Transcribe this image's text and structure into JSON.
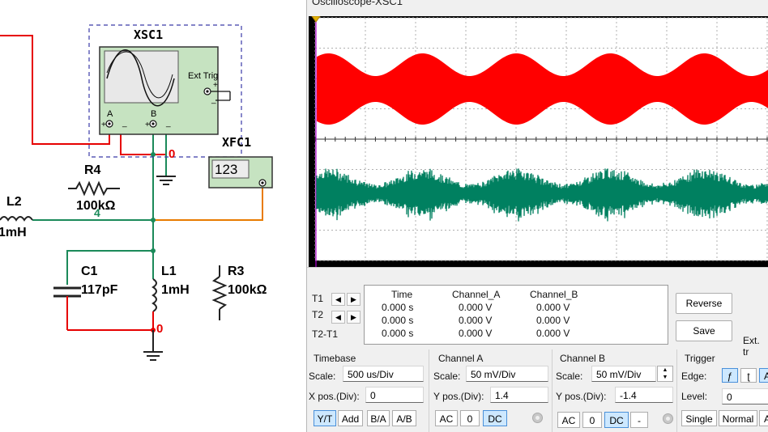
{
  "schematic": {
    "oscilloscope": {
      "name": "XSC1",
      "ext_trig": "Ext Trig",
      "pin_a": "A",
      "pin_b": "B",
      "plus": "+",
      "minus": "_"
    },
    "counter": {
      "name": "XFC1",
      "display": "123"
    },
    "r4": {
      "name": "R4",
      "value": "100kΩ"
    },
    "l2": {
      "name": "L2",
      "value": "1mH"
    },
    "c1": {
      "name": "C1",
      "value": "117pF"
    },
    "l1": {
      "name": "L1",
      "value": "1mH"
    },
    "r3": {
      "name": "R3",
      "value": "100kΩ"
    },
    "nets": {
      "gnd_top": "0",
      "node4": "4",
      "gnd_bottom": "0"
    },
    "colors": {
      "wire_red": "#e60000",
      "wire_green": "#1b8a5a",
      "wire_orange": "#e87b00",
      "instrument_fill": "#c6e3c1",
      "selection": "#3a3aa8"
    }
  },
  "oscilloscope_window": {
    "title": "Oscilloscope-XSC1",
    "trace_colors": {
      "channel_a": "#ff0000",
      "channel_b": "#008060"
    },
    "cursors": {
      "t1_label": "T1",
      "t2_label": "T2",
      "t2t1_label": "T2-T1",
      "left_arrow": "◀",
      "right_arrow": "▶",
      "headers": {
        "time": "Time",
        "channel_a": "Channel_A",
        "channel_b": "Channel_B"
      },
      "rows": [
        {
          "time": "0.000 s",
          "a": "0.000 V",
          "b": "0.000 V"
        },
        {
          "time": "0.000 s",
          "a": "0.000 V",
          "b": "0.000 V"
        },
        {
          "time": "0.000 s",
          "a": "0.000 V",
          "b": "0.000 V"
        }
      ]
    },
    "buttons": {
      "reverse": "Reverse",
      "save": "Save",
      "ext_trigger": "Ext. tr"
    },
    "timebase": {
      "header": "Timebase",
      "scale_label": "Scale:",
      "scale_value": "500 us/Div",
      "xpos_label": "X pos.(Div):",
      "xpos_value": "0",
      "modes": [
        "Y/T",
        "Add",
        "B/A",
        "A/B"
      ]
    },
    "channel_a": {
      "header": "Channel A",
      "scale_label": "Scale:",
      "scale_value": "50 mV/Div",
      "ypos_label": "Y pos.(Div):",
      "ypos_value": "1.4",
      "coupling": [
        "AC",
        "0",
        "DC"
      ]
    },
    "channel_b": {
      "header": "Channel B",
      "scale_label": "Scale:",
      "scale_value": "50 mV/Div",
      "ypos_label": "Y pos.(Div):",
      "ypos_value": "-1.4",
      "coupling": [
        "AC",
        "0",
        "DC",
        "-"
      ]
    },
    "trigger": {
      "header": "Trigger",
      "edge_label": "Edge:",
      "edge_rising": "ƒ",
      "edge_falling": "ʈ",
      "edge_a": "A",
      "level_label": "Level:",
      "level_value": "0",
      "modes": [
        "Single",
        "Normal",
        "A"
      ]
    }
  }
}
